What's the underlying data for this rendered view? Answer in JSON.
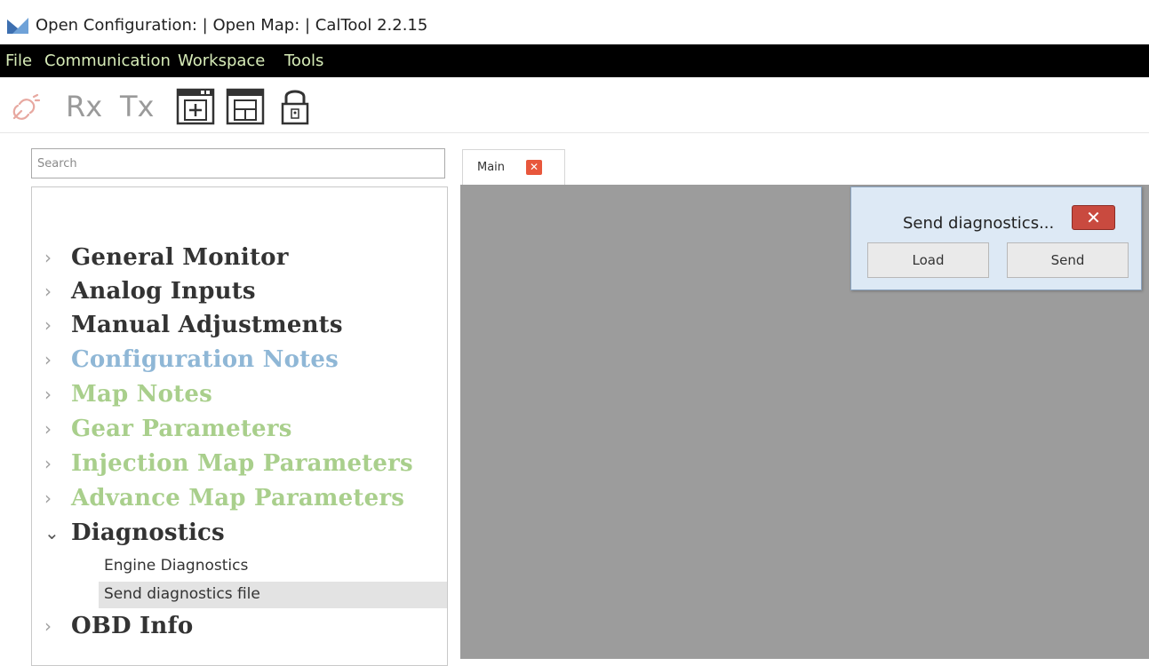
{
  "window": {
    "title": "Open Configuration: | Open Map: | CalTool 2.2.15"
  },
  "menu": [
    "File",
    "Communication",
    "Workspace",
    "Tools"
  ],
  "toolbar": {
    "rx_label": "Rx",
    "tx_label": "Tx",
    "icons": [
      "connect-link-icon",
      "add-window-icon",
      "layout-icon",
      "lock-icon"
    ]
  },
  "search": {
    "placeholder": "Search"
  },
  "tree": {
    "items": [
      {
        "label": "General Monitor",
        "state": "collapsed",
        "color": "#333333"
      },
      {
        "label": "Analog Inputs",
        "state": "collapsed",
        "color": "#333333"
      },
      {
        "label": "Manual Adjustments",
        "state": "collapsed",
        "color": "#333333"
      },
      {
        "label": "Configuration Notes",
        "state": "collapsed",
        "color": "#8fb7d6"
      },
      {
        "label": "Map Notes",
        "state": "collapsed",
        "color": "#a9cf8c"
      },
      {
        "label": "Gear Parameters",
        "state": "collapsed",
        "color": "#a9cf8c"
      },
      {
        "label": "Injection Map Parameters",
        "state": "collapsed",
        "color": "#a9cf8c"
      },
      {
        "label": "Advance Map Parameters",
        "state": "collapsed",
        "color": "#a9cf8c"
      },
      {
        "label": "Diagnostics",
        "state": "expanded",
        "color": "#333333"
      },
      {
        "label": "OBD Info",
        "state": "collapsed",
        "color": "#333333"
      }
    ],
    "diagnostics_children": [
      "Engine Diagnostics",
      "Send diagnostics file"
    ],
    "selected_child": "Send diagnostics file"
  },
  "tabs": [
    {
      "label": "Main"
    }
  ],
  "dialog": {
    "title": "Send diagnostics...",
    "close_symbol": "✕",
    "buttons": [
      "Load",
      "Send"
    ]
  },
  "colors": {
    "menubar_bg": "#000000",
    "menu_text": "#d7ecb8",
    "workspace_bg": "#9c9c9c",
    "dialog_bg": "#dde9f5",
    "close_button": "#c94a3f",
    "tab_close": "#e8573c"
  }
}
